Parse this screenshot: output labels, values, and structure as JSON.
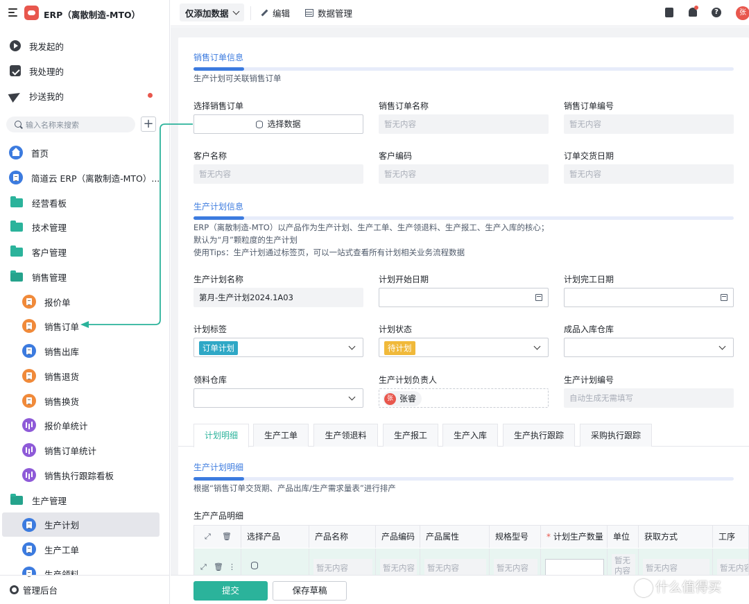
{
  "app": {
    "title": "ERP（离散制造-MTO）"
  },
  "quick": [
    {
      "label": "我发起的",
      "icon": "play-circle-icon"
    },
    {
      "label": "我处理的",
      "icon": "check-box-icon"
    },
    {
      "label": "抄送我的",
      "icon": "send-icon"
    }
  ],
  "search": {
    "placeholder": "输入名称来搜索",
    "add": "+"
  },
  "nav": [
    {
      "label": "首页",
      "icon": "home-icon"
    },
    {
      "label": "简道云 ERP（离散制造-MTO）...",
      "icon": "doc-icon"
    },
    {
      "label": "经营看板",
      "icon": "folder-icon"
    },
    {
      "label": "技术管理",
      "icon": "folder-icon"
    },
    {
      "label": "客户管理",
      "icon": "folder-icon"
    },
    {
      "label": "销售管理",
      "icon": "folder-open-icon"
    },
    {
      "label": "报价单",
      "icon": "doc-icon"
    },
    {
      "label": "销售订单",
      "icon": "doc-icon"
    },
    {
      "label": "销售出库",
      "icon": "doc-icon"
    },
    {
      "label": "销售退货",
      "icon": "doc-icon"
    },
    {
      "label": "销售换货",
      "icon": "doc-icon"
    },
    {
      "label": "报价单统计",
      "icon": "chart-icon"
    },
    {
      "label": "销售订单统计",
      "icon": "chart-icon"
    },
    {
      "label": "销售执行跟踪看板",
      "icon": "chart-icon"
    },
    {
      "label": "生产管理",
      "icon": "folder-open-icon"
    },
    {
      "label": "生产计划",
      "icon": "doc-icon"
    },
    {
      "label": "生产工单",
      "icon": "doc-icon"
    },
    {
      "label": "生产领料",
      "icon": "doc-icon"
    }
  ],
  "admin": {
    "label": "管理后台"
  },
  "toolbar": {
    "mode": "仅添加数据",
    "edit": "编辑",
    "data_manage": "数据管理",
    "help": "?",
    "user_initial": "张"
  },
  "sales_section": {
    "title": "销售订单信息",
    "desc": "生产计划可关联销售订单",
    "select_order_label": "选择销售订单",
    "select_data_btn": "选择数据",
    "order_name_label": "销售订单名称",
    "order_no_label": "销售订单编号",
    "customer_name_label": "客户名称",
    "customer_code_label": "客户编码",
    "delivery_date_label": "订单交货日期",
    "empty": "暂无内容"
  },
  "plan_section": {
    "title": "生产计划信息",
    "desc1": "ERP（离散制造-MTO）以产品作为生产计划、生产工单、生产领退料、生产报工、生产入库的核心；",
    "desc2": "默认为“月”颗粒度的生产计划",
    "desc3": "使用Tips：生产计划通过标签页，可以一站式查看所有计划相关业务流程数据",
    "plan_name_label": "生产计划名称",
    "plan_name_value": "第月-生产计划2024.1A03",
    "start_date_label": "计划开始日期",
    "end_date_label": "计划完工日期",
    "tag_label": "计划标签",
    "tag_value": "订单计划",
    "tag_color": "#2fa8c6",
    "status_label": "计划状态",
    "status_value": "待计划",
    "status_color": "#f0b93a",
    "warehouse_label": "成品入库仓库",
    "material_wh_label": "领料仓库",
    "owner_label": "生产计划负责人",
    "owner_initial": "张",
    "owner_name": "张睿",
    "plan_no_label": "生产计划编号",
    "plan_no_placeholder": "自动生成无需填写"
  },
  "tabs": [
    "计划明细",
    "生产工单",
    "生产领退料",
    "生产报工",
    "生产入库",
    "生产执行跟踪",
    "采购执行跟踪"
  ],
  "detail_section": {
    "title": "生产计划明细",
    "desc": "根据“销售订单交货期、产品出库/生产需求量表”进行排产",
    "table_title": "生产产品明细"
  },
  "table": {
    "headers": [
      "选择产品",
      "产品名称",
      "产品编码",
      "产品属性",
      "规格型号",
      "计划生产数量",
      "单位",
      "获取方式",
      "工序"
    ],
    "required_mark": "*",
    "row": {
      "empty": "暂无内容",
      "unit_empty": "暂无内容"
    }
  },
  "footer": {
    "submit": "提交",
    "draft": "保存草稿"
  },
  "watermark": "什么值得买",
  "colors": {
    "accent": "#2bb39b",
    "primary": "#3c7bdf",
    "danger": "#e8574d"
  }
}
